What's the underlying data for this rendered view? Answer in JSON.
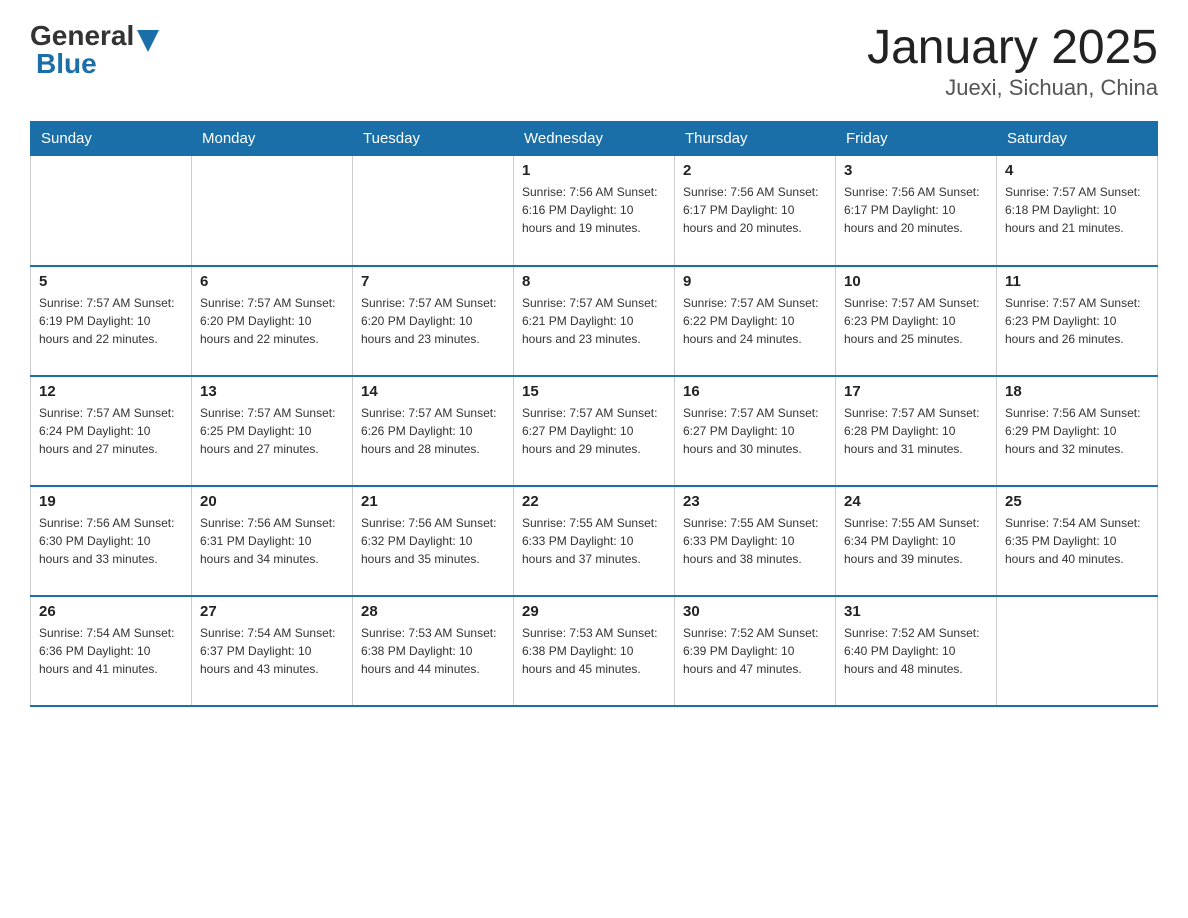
{
  "logo": {
    "general": "General",
    "arrow": "▶",
    "blue": "Blue"
  },
  "title": "January 2025",
  "subtitle": "Juexi, Sichuan, China",
  "days_of_week": [
    "Sunday",
    "Monday",
    "Tuesday",
    "Wednesday",
    "Thursday",
    "Friday",
    "Saturday"
  ],
  "weeks": [
    [
      {
        "day": "",
        "info": ""
      },
      {
        "day": "",
        "info": ""
      },
      {
        "day": "",
        "info": ""
      },
      {
        "day": "1",
        "info": "Sunrise: 7:56 AM\nSunset: 6:16 PM\nDaylight: 10 hours and 19 minutes."
      },
      {
        "day": "2",
        "info": "Sunrise: 7:56 AM\nSunset: 6:17 PM\nDaylight: 10 hours and 20 minutes."
      },
      {
        "day": "3",
        "info": "Sunrise: 7:56 AM\nSunset: 6:17 PM\nDaylight: 10 hours and 20 minutes."
      },
      {
        "day": "4",
        "info": "Sunrise: 7:57 AM\nSunset: 6:18 PM\nDaylight: 10 hours and 21 minutes."
      }
    ],
    [
      {
        "day": "5",
        "info": "Sunrise: 7:57 AM\nSunset: 6:19 PM\nDaylight: 10 hours and 22 minutes."
      },
      {
        "day": "6",
        "info": "Sunrise: 7:57 AM\nSunset: 6:20 PM\nDaylight: 10 hours and 22 minutes."
      },
      {
        "day": "7",
        "info": "Sunrise: 7:57 AM\nSunset: 6:20 PM\nDaylight: 10 hours and 23 minutes."
      },
      {
        "day": "8",
        "info": "Sunrise: 7:57 AM\nSunset: 6:21 PM\nDaylight: 10 hours and 23 minutes."
      },
      {
        "day": "9",
        "info": "Sunrise: 7:57 AM\nSunset: 6:22 PM\nDaylight: 10 hours and 24 minutes."
      },
      {
        "day": "10",
        "info": "Sunrise: 7:57 AM\nSunset: 6:23 PM\nDaylight: 10 hours and 25 minutes."
      },
      {
        "day": "11",
        "info": "Sunrise: 7:57 AM\nSunset: 6:23 PM\nDaylight: 10 hours and 26 minutes."
      }
    ],
    [
      {
        "day": "12",
        "info": "Sunrise: 7:57 AM\nSunset: 6:24 PM\nDaylight: 10 hours and 27 minutes."
      },
      {
        "day": "13",
        "info": "Sunrise: 7:57 AM\nSunset: 6:25 PM\nDaylight: 10 hours and 27 minutes."
      },
      {
        "day": "14",
        "info": "Sunrise: 7:57 AM\nSunset: 6:26 PM\nDaylight: 10 hours and 28 minutes."
      },
      {
        "day": "15",
        "info": "Sunrise: 7:57 AM\nSunset: 6:27 PM\nDaylight: 10 hours and 29 minutes."
      },
      {
        "day": "16",
        "info": "Sunrise: 7:57 AM\nSunset: 6:27 PM\nDaylight: 10 hours and 30 minutes."
      },
      {
        "day": "17",
        "info": "Sunrise: 7:57 AM\nSunset: 6:28 PM\nDaylight: 10 hours and 31 minutes."
      },
      {
        "day": "18",
        "info": "Sunrise: 7:56 AM\nSunset: 6:29 PM\nDaylight: 10 hours and 32 minutes."
      }
    ],
    [
      {
        "day": "19",
        "info": "Sunrise: 7:56 AM\nSunset: 6:30 PM\nDaylight: 10 hours and 33 minutes."
      },
      {
        "day": "20",
        "info": "Sunrise: 7:56 AM\nSunset: 6:31 PM\nDaylight: 10 hours and 34 minutes."
      },
      {
        "day": "21",
        "info": "Sunrise: 7:56 AM\nSunset: 6:32 PM\nDaylight: 10 hours and 35 minutes."
      },
      {
        "day": "22",
        "info": "Sunrise: 7:55 AM\nSunset: 6:33 PM\nDaylight: 10 hours and 37 minutes."
      },
      {
        "day": "23",
        "info": "Sunrise: 7:55 AM\nSunset: 6:33 PM\nDaylight: 10 hours and 38 minutes."
      },
      {
        "day": "24",
        "info": "Sunrise: 7:55 AM\nSunset: 6:34 PM\nDaylight: 10 hours and 39 minutes."
      },
      {
        "day": "25",
        "info": "Sunrise: 7:54 AM\nSunset: 6:35 PM\nDaylight: 10 hours and 40 minutes."
      }
    ],
    [
      {
        "day": "26",
        "info": "Sunrise: 7:54 AM\nSunset: 6:36 PM\nDaylight: 10 hours and 41 minutes."
      },
      {
        "day": "27",
        "info": "Sunrise: 7:54 AM\nSunset: 6:37 PM\nDaylight: 10 hours and 43 minutes."
      },
      {
        "day": "28",
        "info": "Sunrise: 7:53 AM\nSunset: 6:38 PM\nDaylight: 10 hours and 44 minutes."
      },
      {
        "day": "29",
        "info": "Sunrise: 7:53 AM\nSunset: 6:38 PM\nDaylight: 10 hours and 45 minutes."
      },
      {
        "day": "30",
        "info": "Sunrise: 7:52 AM\nSunset: 6:39 PM\nDaylight: 10 hours and 47 minutes."
      },
      {
        "day": "31",
        "info": "Sunrise: 7:52 AM\nSunset: 6:40 PM\nDaylight: 10 hours and 48 minutes."
      },
      {
        "day": "",
        "info": ""
      }
    ]
  ]
}
